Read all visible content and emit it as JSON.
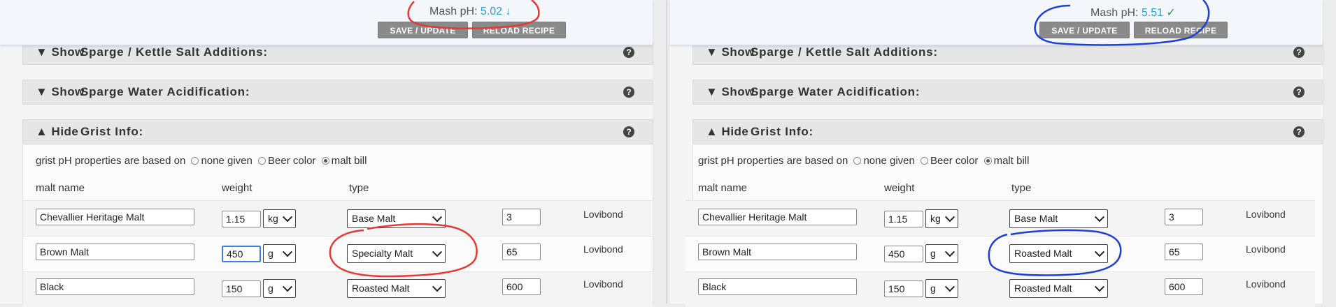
{
  "left": {
    "mash_ph_label": "Mash pH:",
    "mash_ph_value": "5.02",
    "mash_ph_trend": "↓",
    "save_label": "SAVE / UPDATE",
    "reload_label": "RELOAD RECIPE",
    "panels": {
      "sparge_salt": {
        "toggle": "▼ Show",
        "title": "Sparge / Kettle Salt Additions:"
      },
      "sparge_acid": {
        "toggle": "▼ Show",
        "title": "Sparge Water Acidification:"
      },
      "grist": {
        "toggle": "▲ Hide",
        "title": "Grist Info:"
      }
    },
    "help_icon": "?",
    "grist_ph_label": "grist pH properties are based on",
    "options": {
      "none": "none given",
      "beer": "Beer color",
      "malt": "malt bill"
    },
    "headers": {
      "name": "malt name",
      "weight": "weight",
      "type": "type"
    },
    "rows": [
      {
        "name": "Chevallier Heritage Malt",
        "weight": "1.15",
        "unit": "kg",
        "type": "Base Malt",
        "color": "3",
        "color_unit": "Lovibond"
      },
      {
        "name": "Brown Malt",
        "weight": "450",
        "unit": "g",
        "type": "Specialty Malt",
        "color": "65",
        "color_unit": "Lovibond"
      },
      {
        "name": "Black",
        "weight": "150",
        "unit": "g",
        "type": "Roasted Malt",
        "color": "600",
        "color_unit": "Lovibond"
      }
    ]
  },
  "right": {
    "mash_ph_label": "Mash pH:",
    "mash_ph_value": "5.51",
    "mash_ph_trend": "✓",
    "save_label": "SAVE / UPDATE",
    "reload_label": "RELOAD RECIPE",
    "panels": {
      "sparge_salt": {
        "toggle": "▼ Show",
        "title": "Sparge / Kettle Salt Additions:"
      },
      "sparge_acid": {
        "toggle": "▼ Show",
        "title": "Sparge Water Acidification:"
      },
      "grist": {
        "toggle": "▲ Hide",
        "title": "Grist Info:"
      }
    },
    "help_icon": "?",
    "grist_ph_label": "grist pH properties are based on",
    "options": {
      "none": "none given",
      "beer": "Beer color",
      "malt": "malt bill"
    },
    "headers": {
      "name": "malt name",
      "weight": "weight",
      "type": "type"
    },
    "rows": [
      {
        "name": "Chevallier Heritage Malt",
        "weight": "1.15",
        "unit": "kg",
        "type": "Base Malt",
        "color": "3",
        "color_unit": "Lovibond"
      },
      {
        "name": "Brown Malt",
        "weight": "450",
        "unit": "g",
        "type": "Roasted Malt",
        "color": "65",
        "color_unit": "Lovibond"
      },
      {
        "name": "Black",
        "weight": "150",
        "unit": "g",
        "type": "Roasted Malt",
        "color": "600",
        "color_unit": "Lovibond"
      }
    ]
  },
  "annotation_colors": {
    "left": "#e53935",
    "right": "#1e3fd6"
  },
  "grist_malt_bill_selected": true
}
